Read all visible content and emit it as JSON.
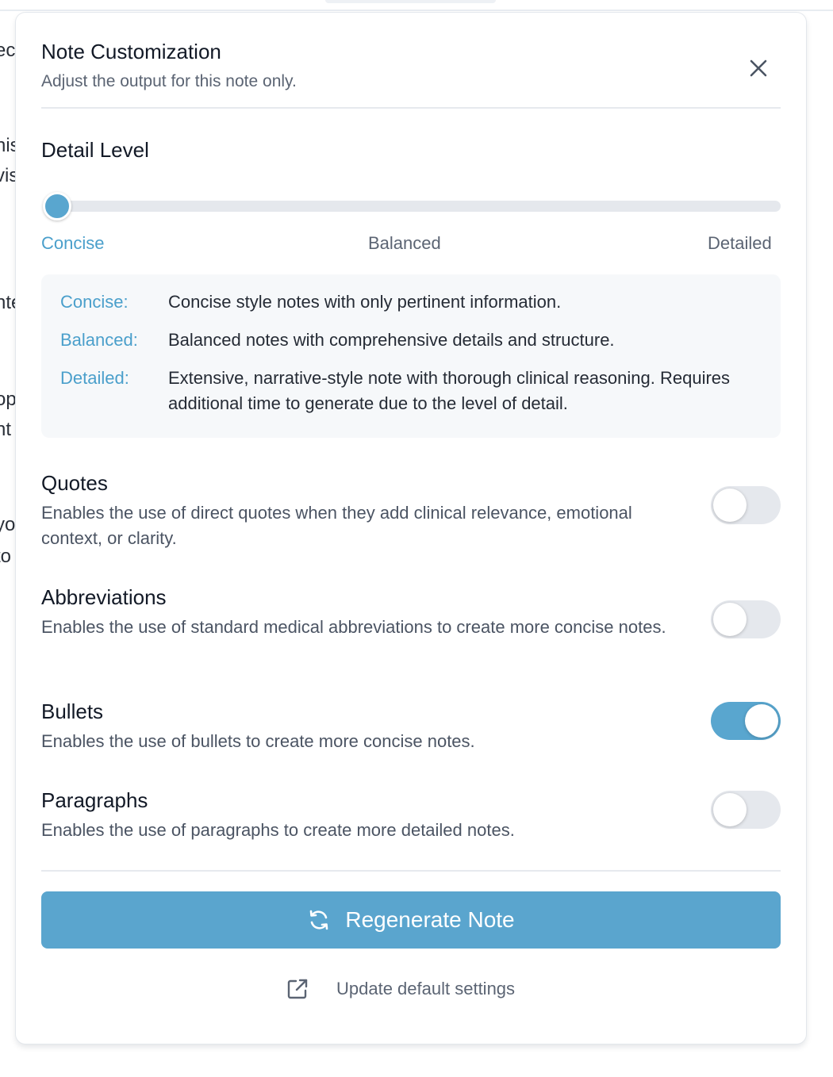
{
  "background": {
    "fragments": [
      "ec",
      "his",
      "vis",
      "nte",
      "op",
      "nt",
      "yo",
      "to"
    ]
  },
  "panel": {
    "title": "Note Customization",
    "subtitle": "Adjust the output for this note only.",
    "close_icon": "close-icon"
  },
  "detail_level": {
    "label": "Detail Level",
    "options": [
      "Concise",
      "Balanced",
      "Detailed"
    ],
    "selected": "Concise",
    "value_fraction": 0.0
  },
  "descriptions": [
    {
      "key": "Concise:",
      "text": "Concise style notes with only pertinent information."
    },
    {
      "key": "Balanced:",
      "text": "Balanced notes with comprehensive details and structure."
    },
    {
      "key": "Detailed:",
      "text": "Extensive, narrative-style note with thorough clinical reasoning. Requires additional time to generate due to the level of detail."
    }
  ],
  "options": [
    {
      "title": "Quotes",
      "description": "Enables the use of direct quotes when they add clinical relevance, emotional context, or clarity.",
      "enabled": false
    },
    {
      "title": "Abbreviations",
      "description": "Enables the use of standard medical abbreviations to create more concise notes.",
      "enabled": false
    },
    {
      "title": "Bullets",
      "description": "Enables the use of bullets to create more concise notes.",
      "enabled": true
    },
    {
      "title": "Paragraphs",
      "description": "Enables the use of paragraphs to create more detailed notes.",
      "enabled": false
    }
  ],
  "actions": {
    "regenerate_label": "Regenerate Note",
    "regenerate_icon": "refresh-icon",
    "update_defaults_label": "Update default settings",
    "update_defaults_icon": "external-link-icon"
  },
  "colors": {
    "accent": "#59a6cf",
    "accent_text": "#4a9fcb",
    "toggle_off": "#e5e8ed"
  }
}
